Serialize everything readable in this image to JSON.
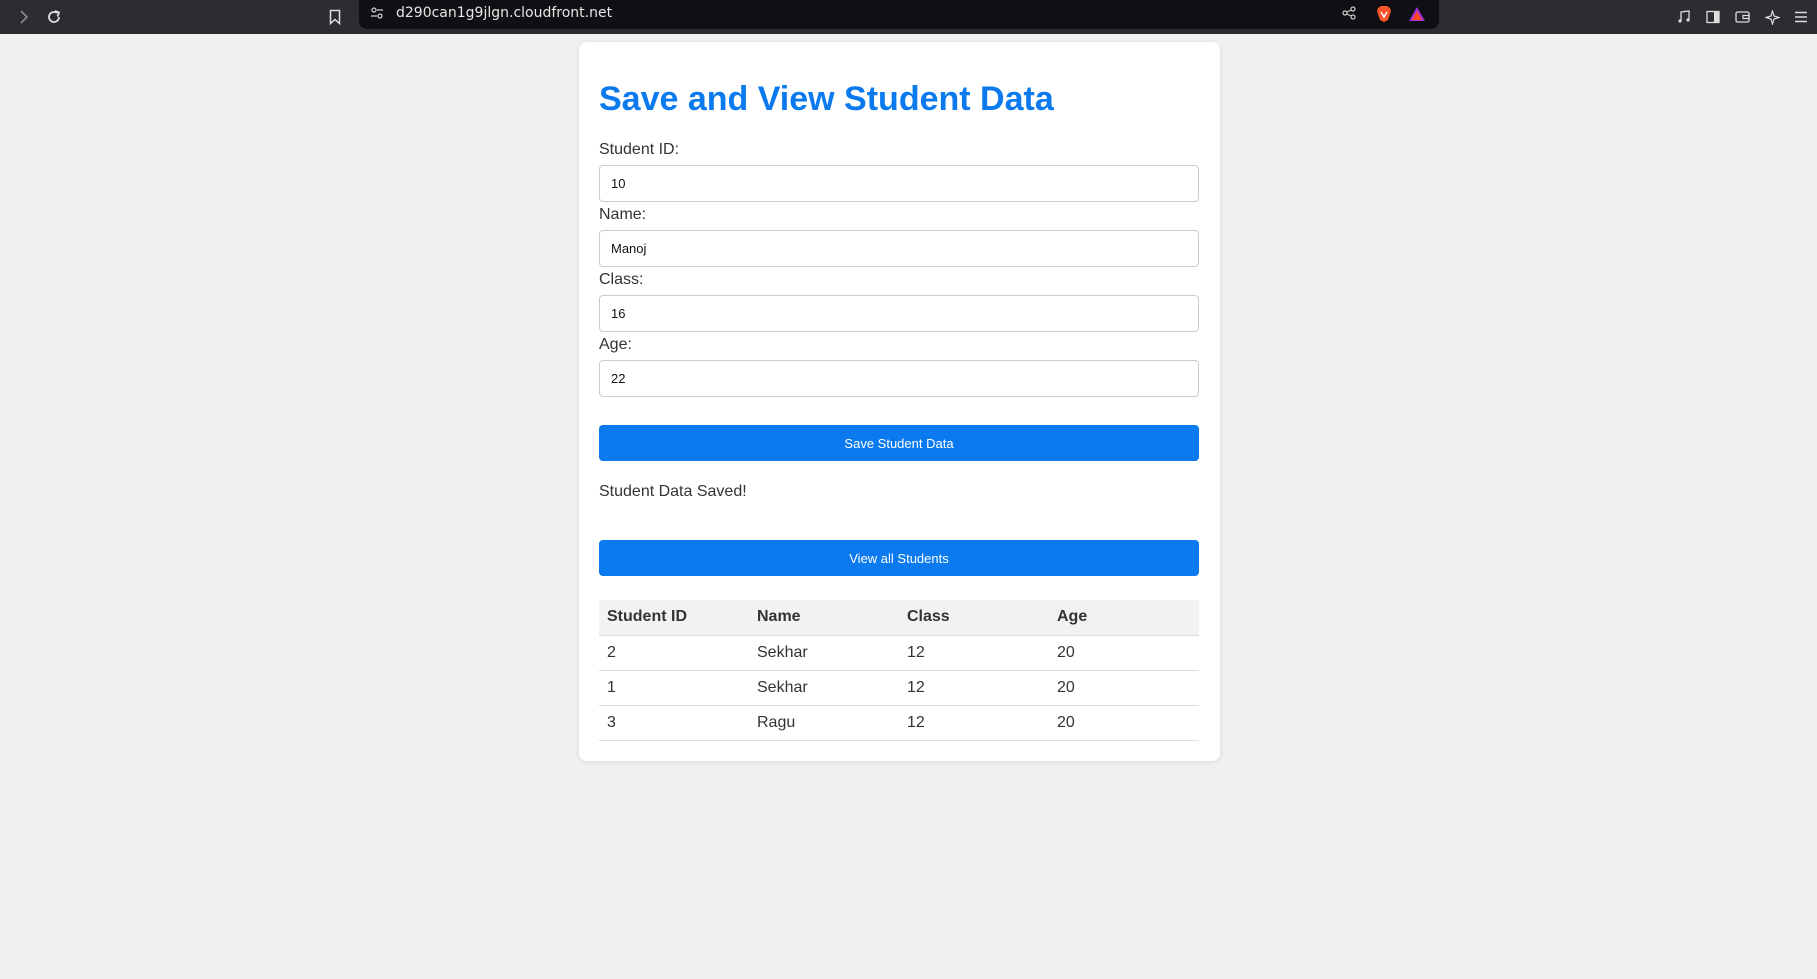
{
  "browser": {
    "url": "d290can1g9jlgn.cloudfront.net"
  },
  "page": {
    "title": "Save and View Student Data",
    "form": {
      "student_id_label": "Student ID:",
      "student_id_value": "10",
      "name_label": "Name:",
      "name_value": "Manoj",
      "class_label": "Class:",
      "class_value": "16",
      "age_label": "Age:",
      "age_value": "22",
      "save_button": "Save Student Data"
    },
    "status_message": "Student Data Saved!",
    "view_button": "View all Students",
    "table": {
      "headers": [
        "Student ID",
        "Name",
        "Class",
        "Age"
      ],
      "rows": [
        [
          "2",
          "Sekhar",
          "12",
          "20"
        ],
        [
          "1",
          "Sekhar",
          "12",
          "20"
        ],
        [
          "3",
          "Ragu",
          "12",
          "20"
        ]
      ]
    }
  },
  "colors": {
    "accent": "#0a7aee",
    "page_bg": "#f0f0f0",
    "chrome_bg": "#2b2d31"
  }
}
